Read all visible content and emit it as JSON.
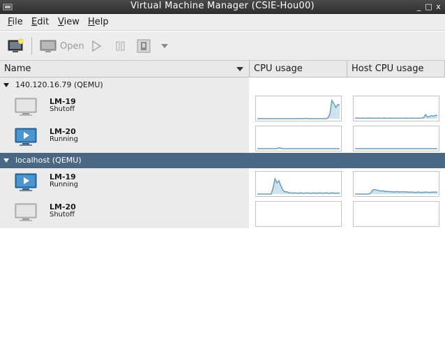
{
  "window": {
    "title": "Virtual Machine Manager (CSIE-Hou00)",
    "controls": [
      "_",
      "□",
      "x"
    ]
  },
  "menubar": {
    "items": [
      {
        "mnemonic": "F",
        "rest": "ile"
      },
      {
        "mnemonic": "E",
        "rest": "dit"
      },
      {
        "mnemonic": "V",
        "rest": "iew"
      },
      {
        "mnemonic": "H",
        "rest": "elp"
      }
    ]
  },
  "toolbar": {
    "new_icon": "new-vm-icon",
    "open_label": "Open",
    "run_icon": "play-icon",
    "pause_icon": "pause-icon",
    "shutdown_icon": "shutdown-icon",
    "menu_icon": "dropdown-arrow-icon"
  },
  "columns": {
    "name": "Name",
    "cpu": "CPU usage",
    "host_cpu": "Host CPU usage"
  },
  "colors": {
    "selection": "#4a6884",
    "graph_line": "#6b9cb8",
    "graph_fill": "#cfe3ef",
    "running_icon": "#2f79b7"
  },
  "connections": [
    {
      "label": "140.120.16.79 (QEMU)",
      "selected": false,
      "vms": [
        {
          "name": "LM-19",
          "status": "Shutoff",
          "icon": "vm-shutoff-icon",
          "cpu": [
            0,
            0,
            0,
            0,
            0,
            0,
            0,
            0,
            0,
            0,
            0,
            0,
            0,
            0,
            0,
            0,
            0,
            0,
            0,
            0,
            0,
            0,
            0.01,
            0,
            0,
            0.02,
            0,
            0,
            0,
            0,
            0,
            0,
            0,
            0,
            0,
            0,
            0.03,
            0.25,
            0.9,
            0.75,
            0.55,
            0.7,
            0.65
          ],
          "host": [
            0.02,
            0.03,
            0.02,
            0.02,
            0.03,
            0.02,
            0.02,
            0.03,
            0.02,
            0.03,
            0.02,
            0.02,
            0.03,
            0.02,
            0.02,
            0.03,
            0.02,
            0.02,
            0.03,
            0.02,
            0.03,
            0.02,
            0.02,
            0.03,
            0.02,
            0.02,
            0.03,
            0.02,
            0.02,
            0.03,
            0.02,
            0.02,
            0.03,
            0.02,
            0.03,
            0.05,
            0.2,
            0.08,
            0.1,
            0.15,
            0.12,
            0.16,
            0.17
          ]
        },
        {
          "name": "LM-20",
          "status": "Running",
          "icon": "vm-running-icon",
          "cpu": [
            0,
            0,
            0,
            0,
            0,
            0,
            0,
            0,
            0,
            0,
            0,
            0.05,
            0.02,
            0,
            0,
            0,
            0,
            0,
            0,
            0,
            0,
            0,
            0,
            0,
            0,
            0,
            0,
            0,
            0,
            0,
            0,
            0,
            0,
            0,
            0,
            0,
            0,
            0,
            0,
            0,
            0,
            0,
            0
          ],
          "host": [
            0,
            0,
            0,
            0,
            0,
            0,
            0,
            0,
            0,
            0,
            0,
            0,
            0,
            0,
            0,
            0,
            0,
            0,
            0,
            0,
            0,
            0,
            0,
            0,
            0,
            0,
            0,
            0,
            0,
            0,
            0,
            0,
            0,
            0,
            0,
            0,
            0,
            0,
            0,
            0,
            0,
            0,
            0
          ]
        }
      ]
    },
    {
      "label": "localhost (QEMU)",
      "selected": true,
      "vms": [
        {
          "name": "LM-19",
          "status": "Running",
          "icon": "vm-running-icon",
          "cpu": [
            0,
            0,
            0,
            0,
            0,
            0,
            0,
            0,
            0.3,
            0.75,
            0.55,
            0.65,
            0.4,
            0.2,
            0.1,
            0.12,
            0.05,
            0.07,
            0.04,
            0.06,
            0.05,
            0.04,
            0.06,
            0.05,
            0.04,
            0.06,
            0.05,
            0.04,
            0.05,
            0.06,
            0.04,
            0.05,
            0.06,
            0.04,
            0.05,
            0.06,
            0.05,
            0.04,
            0.06,
            0.05,
            0.04,
            0.05,
            0.05
          ],
          "host": [
            0,
            0,
            0,
            0,
            0,
            0,
            0,
            0,
            0.05,
            0.2,
            0.22,
            0.2,
            0.18,
            0.15,
            0.16,
            0.14,
            0.12,
            0.13,
            0.11,
            0.12,
            0.1,
            0.12,
            0.11,
            0.1,
            0.12,
            0.1,
            0.11,
            0.1,
            0.09,
            0.1,
            0.09,
            0.08,
            0.1,
            0.09,
            0.08,
            0.09,
            0.1,
            0.09,
            0.08,
            0.09,
            0.1,
            0.09,
            0.1
          ]
        },
        {
          "name": "LM-20",
          "status": "Shutoff",
          "icon": "vm-shutoff-icon",
          "cpu": [],
          "host": []
        }
      ]
    }
  ]
}
